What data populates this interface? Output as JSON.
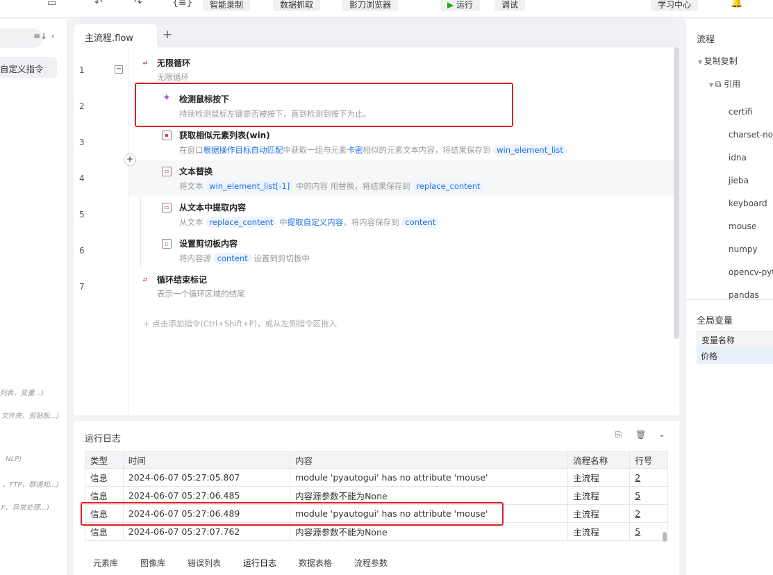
{
  "toolbar": {
    "smart_record": "智能录制",
    "data_capture": "数据抓取",
    "browser": "影刀浏览器",
    "run": "运行",
    "debug": "调试",
    "learning": "学习中心"
  },
  "left": {
    "custom_cmd": "自定义指令",
    "hints": [
      "列表、变量...)",
      "文件夹、剪贴板...)",
      "NLP)",
      "、FTP、群通知...)",
      "F、异常处理...)"
    ]
  },
  "tabs": {
    "active": "主流程.flow",
    "add": "+"
  },
  "flow": [
    {
      "num": "1",
      "title": "无限循环",
      "desc": "无限循环"
    },
    {
      "num": "2",
      "title": "检测鼠标按下",
      "desc": "持续检测鼠标左键是否被按下，直到检测到按下为止。"
    },
    {
      "num": "3",
      "title": "获取相似元素列表(win)",
      "d1": "在窗口",
      "d2": "根据操作目标自动匹配",
      "d3": "中获取一组与元素",
      "d4": "卡密",
      "d5": "相似的元素文本内容，将结果保存到",
      "v1": "win_element_list"
    },
    {
      "num": "4",
      "title": "文本替换",
      "d1": "将文本",
      "v1": "win_element_list[-1]",
      "d2": "中的内容 用替换，将结果保存到",
      "v2": "replace_content"
    },
    {
      "num": "5",
      "title": "从文本中提取内容",
      "d1": "从文本",
      "v1": "replace_content",
      "d2": "中",
      "d3": "提取自定义内容",
      "d4": "，将内容保存到",
      "v2": "content"
    },
    {
      "num": "6",
      "title": "设置剪切板内容",
      "d1": "将内容源",
      "v1": "content",
      "d2": "设置到剪切板中"
    },
    {
      "num": "7",
      "title": "循环结束标记",
      "desc": "表示一个循环区域的结尾"
    }
  ],
  "add_hint": "+ 点击添加指令(Ctrl+Shift+P)，或从左侧指令区拖入",
  "log": {
    "title": "运行日志",
    "headers": [
      "类型",
      "时间",
      "内容",
      "流程名称",
      "行号"
    ],
    "rows": [
      [
        "信息",
        "2024-06-07 05:27:05.807",
        "module 'pyautogui' has no attribute 'mouse'",
        "主流程",
        "2"
      ],
      [
        "信息",
        "2024-06-07 05:27:06.485",
        "内容源参数不能为None",
        "主流程",
        "5"
      ],
      [
        "信息",
        "2024-06-07 05:27:06.489",
        "module 'pyautogui' has no attribute 'mouse'",
        "主流程",
        "2"
      ],
      [
        "信息",
        "2024-06-07 05:27:07.762",
        "内容源参数不能为None",
        "主流程",
        "5"
      ]
    ]
  },
  "bottom_tabs": [
    "元素库",
    "图像库",
    "错误列表",
    "运行日志",
    "数据表格",
    "流程参数"
  ],
  "right": {
    "title": "流程",
    "group": "复制复制",
    "ref": "引用",
    "packages": [
      "certifi",
      "charset-nor",
      "idna",
      "jieba",
      "keyboard",
      "mouse",
      "numpy",
      "opencv-pyt",
      "pandas"
    ],
    "globals_title": "全局变量",
    "var_header": "变量名称",
    "var_row": "价格"
  }
}
